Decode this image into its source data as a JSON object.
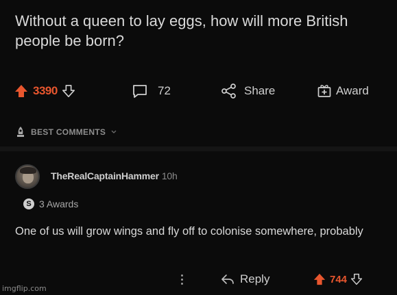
{
  "post": {
    "title": "Without a queen to lay eggs, how will more British people be born?"
  },
  "actions": {
    "score": "3390",
    "comment_count": "72",
    "share_label": "Share",
    "award_label": "Award"
  },
  "sort": {
    "label": "BEST COMMENTS"
  },
  "comment": {
    "username": "TheRealCaptainHammer",
    "time": "10h",
    "awards_label": "3 Awards",
    "award_icon_text": "S",
    "body": "One of us will grow wings and fly off to colonise somewhere, probably",
    "reply_label": "Reply",
    "score": "744"
  },
  "watermark": "imgflip.com",
  "colors": {
    "background": "#0b0b0b",
    "upvote": "#e8562e",
    "text": "#d9d9d9"
  }
}
